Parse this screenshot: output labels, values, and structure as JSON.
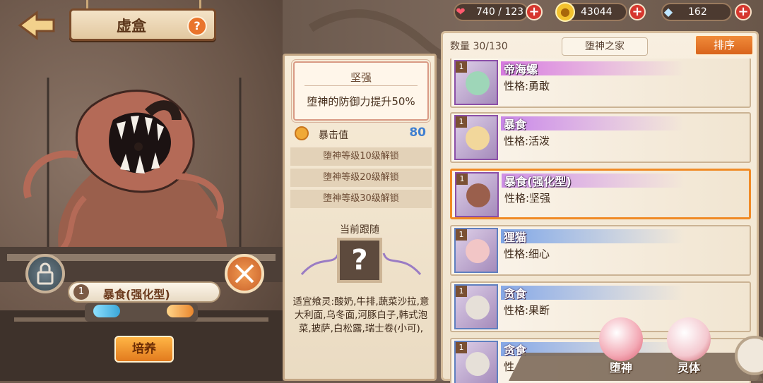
{
  "header": {
    "title": "虚盒",
    "help_label": "?"
  },
  "resources": {
    "stamina": "740 / 123",
    "coins": "43044",
    "crystals": "162",
    "plus_label": "+"
  },
  "selected": {
    "level": "1",
    "name": "暴食(强化型)",
    "cultivate_label": "培养"
  },
  "info": {
    "trait_name": "坚强",
    "trait_desc": "堕神的防御力提升50%",
    "crit_label": "暴击值",
    "crit_value": "80",
    "unlocks": [
      "堕神等级10级解锁",
      "堕神等级20级解锁",
      "堕神等级30级解锁"
    ],
    "follow_title": "当前跟随",
    "follow_placeholder": "?",
    "foods": "适宜飨灵:酸奶,牛排,蔬菜沙拉,意大利面,乌冬面,河豚白子,韩式泡菜,披萨,白松露,瑞士卷(小可),"
  },
  "list": {
    "count": "数量 30/130",
    "filter": "堕神之家",
    "sort_label": "排序",
    "items": [
      {
        "level": "1",
        "name": "帝海螺",
        "trait": "性格:勇敢",
        "bar": "#d77ae0"
      },
      {
        "level": "1",
        "name": "暴食",
        "trait": "性格:活泼",
        "bar": "#c986e8"
      },
      {
        "level": "1",
        "name": "暴食(强化型)",
        "trait": "性格:坚强",
        "bar": "#cf8fe6"
      },
      {
        "level": "1",
        "name": "狸猫",
        "trait": "性格:细心",
        "bar": "#7fa6e6"
      },
      {
        "level": "1",
        "name": "贪食",
        "trait": "性格:果断",
        "bar": "#86a8e6"
      },
      {
        "level": "1",
        "name": "贪食",
        "trait": "性",
        "bar": "#86a8e6"
      }
    ]
  },
  "tabs": {
    "fallen": "堕神",
    "spirit": "灵体"
  },
  "colors": {
    "accent": "#f08a25",
    "frame": "#7a4b2a"
  }
}
